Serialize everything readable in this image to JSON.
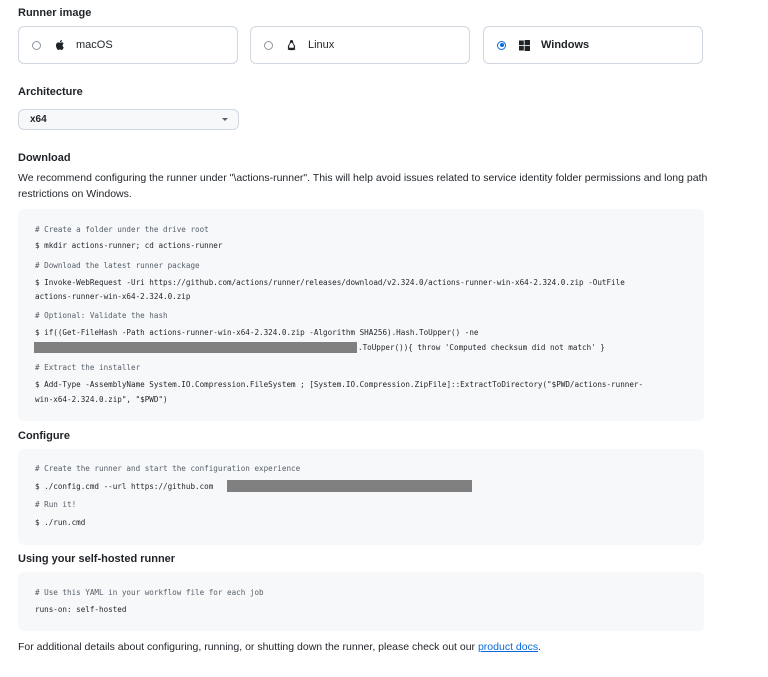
{
  "runner_image": {
    "title": "Runner image",
    "options": [
      {
        "label": "macOS",
        "icon": "apple-icon",
        "selected": false
      },
      {
        "label": "Linux",
        "icon": "linux-tux-icon",
        "selected": false
      },
      {
        "label": "Windows",
        "icon": "windows-logo-icon",
        "selected": true
      }
    ]
  },
  "architecture": {
    "title": "Architecture",
    "selected": "x64"
  },
  "download": {
    "title": "Download",
    "description": "We recommend configuring the runner under \"\\actions-runner\". This will help avoid issues related to service identity folder permissions and long path restrictions on Windows.",
    "code": {
      "c1": "# Create a folder under the drive root",
      "l1": "$ mkdir actions-runner; cd actions-runner",
      "c2": "# Download the latest runner package",
      "l2a": "$ Invoke-WebRequest -Uri https://github.com/actions/runner/releases/download/v2.324.0/actions-runner-win-x64-2.324.0.zip -OutFile",
      "l2b": "actions-runner-win-x64-2.324.0.zip",
      "c3": "# Optional: Validate the hash",
      "l3a": "$ if((Get-FileHash -Path actions-runner-win-x64-2.324.0.zip -Algorithm SHA256).Hash.ToUpper() -ne",
      "l3b": ".ToUpper()){ throw 'Computed checksum did not match' }",
      "c4": "# Extract the installer",
      "l4a": "$ Add-Type -AssemblyName System.IO.Compression.FileSystem ; [System.IO.Compression.ZipFile]::ExtractToDirectory(\"$PWD/actions-runner-",
      "l4b": "win-x64-2.324.0.zip\", \"$PWD\")"
    }
  },
  "configure": {
    "title": "Configure",
    "code": {
      "c1": "# Create the runner and start the configuration experience",
      "l1": "$ ./config.cmd --url https://github.com",
      "c2": "# Run it!",
      "l2": "$ ./run.cmd"
    }
  },
  "using": {
    "title": "Using your self-hosted runner",
    "code": {
      "c1": "# Use this YAML in your workflow file for each job",
      "l1": "runs-on: self-hosted"
    }
  },
  "footer": {
    "text": "For additional details about configuring, running, or shutting down the runner, please check out our ",
    "link": "product docs",
    "end": "."
  }
}
